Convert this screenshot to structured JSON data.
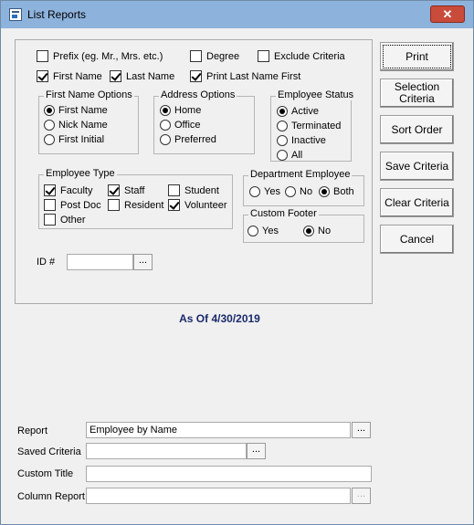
{
  "window": {
    "title": "List Reports",
    "close_label": "✕"
  },
  "name_opts": {
    "prefix": {
      "label": "Prefix (eg. Mr., Mrs. etc.)",
      "checked": false
    },
    "degree": {
      "label": "Degree",
      "checked": false
    },
    "exclude": {
      "label": "Exclude Criteria",
      "checked": false
    },
    "first_name": {
      "label": "First Name",
      "checked": true
    },
    "last_name": {
      "label": "Last Name",
      "checked": true
    },
    "print_last_first": {
      "label": "Print Last Name First",
      "checked": true
    }
  },
  "first_name_options": {
    "legend": "First Name Options",
    "items": [
      {
        "label": "First Name",
        "selected": true
      },
      {
        "label": "Nick Name",
        "selected": false
      },
      {
        "label": "First Initial",
        "selected": false
      }
    ]
  },
  "address_options": {
    "legend": "Address Options",
    "items": [
      {
        "label": "Home",
        "selected": true
      },
      {
        "label": "Office",
        "selected": false
      },
      {
        "label": "Preferred",
        "selected": false
      }
    ]
  },
  "employee_status": {
    "legend": "Employee Status",
    "items": [
      {
        "label": "Active",
        "selected": true
      },
      {
        "label": "Terminated",
        "selected": false
      },
      {
        "label": "Inactive",
        "selected": false
      },
      {
        "label": "All",
        "selected": false
      }
    ]
  },
  "employee_type": {
    "legend": "Employee Type",
    "items": [
      {
        "label": "Faculty",
        "checked": true
      },
      {
        "label": "Staff",
        "checked": true
      },
      {
        "label": "Student",
        "checked": false
      },
      {
        "label": "Post Doc",
        "checked": false
      },
      {
        "label": "Resident",
        "checked": false
      },
      {
        "label": "Volunteer",
        "checked": true
      },
      {
        "label": "Other",
        "checked": false
      }
    ]
  },
  "department_employee": {
    "legend": "Department Employee",
    "items": [
      {
        "label": "Yes",
        "selected": false
      },
      {
        "label": "No",
        "selected": false
      },
      {
        "label": "Both",
        "selected": true
      }
    ]
  },
  "custom_footer": {
    "legend": "Custom Footer",
    "items": [
      {
        "label": "Yes",
        "selected": false
      },
      {
        "label": "No",
        "selected": true
      }
    ]
  },
  "id": {
    "label": "ID #",
    "value": "",
    "browse": "..."
  },
  "buttons": {
    "print": "Print",
    "selection_criteria_1": "Selection",
    "selection_criteria_2": "Criteria",
    "sort_order": "Sort Order",
    "save_criteria": "Save Criteria",
    "clear_criteria": "Clear Criteria",
    "cancel": "Cancel"
  },
  "as_of": "As Of 4/30/2019",
  "bottom": {
    "report_label": "Report",
    "report_value": "Employee by Name",
    "saved_criteria_label": "Saved Criteria",
    "saved_criteria_value": "",
    "custom_title_label": "Custom Title",
    "custom_title_value": "",
    "column_report_label": "Column Report",
    "column_report_value": "",
    "browse": "..."
  }
}
